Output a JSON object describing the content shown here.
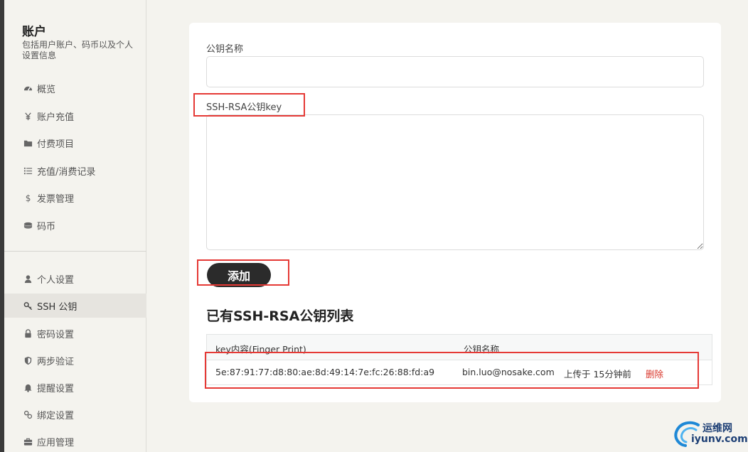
{
  "sidebar": {
    "title": "账户",
    "description": "包括用户账户、码币以及个人设置信息",
    "group1": [
      {
        "label": "概览",
        "icon": "dashboard-icon"
      },
      {
        "label": "账户充值",
        "icon": "yen-icon"
      },
      {
        "label": "付费项目",
        "icon": "folder-icon"
      },
      {
        "label": "充值/消费记录",
        "icon": "list-icon"
      },
      {
        "label": "发票管理",
        "icon": "dollar-icon"
      },
      {
        "label": "码币",
        "icon": "coins-icon"
      }
    ],
    "group2": [
      {
        "label": "个人设置",
        "icon": "user-icon"
      },
      {
        "label": "SSH 公钥",
        "icon": "key-icon",
        "active": true
      },
      {
        "label": "密码设置",
        "icon": "lock-icon"
      },
      {
        "label": "两步验证",
        "icon": "shield-icon"
      },
      {
        "label": "提醒设置",
        "icon": "bell-icon"
      },
      {
        "label": "绑定设置",
        "icon": "link-icon"
      },
      {
        "label": "应用管理",
        "icon": "briefcase-icon"
      }
    ]
  },
  "form": {
    "name_label": "公钥名称",
    "name_value": "",
    "key_label": "SSH-RSA公钥key",
    "key_value": "",
    "add_button": "添加"
  },
  "list": {
    "title": "已有SSH-RSA公钥列表",
    "headers": [
      "key内容(Finger Print)",
      "公钥名称"
    ],
    "rows": [
      {
        "fingerprint": "5e:87:91:77:d8:80:ae:8d:49:14:7e:fc:26:88:fd:a9",
        "name": "bin.luo@nosake.com",
        "uploaded": "上传于 15分钟前",
        "delete": "删除"
      }
    ]
  },
  "watermark": {
    "line1": "运维网",
    "line2": "iyunv.com"
  },
  "colors": {
    "highlight": "#e53935",
    "button": "#2b2b2b",
    "delete": "#d9362b",
    "background": "#f4f3ee"
  }
}
